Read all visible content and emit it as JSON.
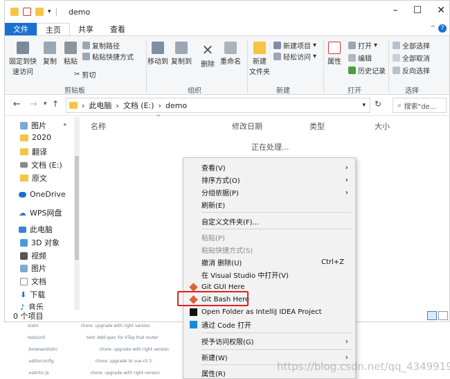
{
  "window": {
    "title": "demo",
    "minimize_glyph": "–",
    "maximize_glyph": "☐",
    "close_glyph": "✕"
  },
  "ribbon_tabs": [
    "文件",
    "主页",
    "共享",
    "查看"
  ],
  "ribbon": {
    "pin_label": "固定到快\n速访问",
    "copy_label": "复制",
    "paste_label": "粘贴",
    "copy_path": "复制路径",
    "paste_shortcut": "粘贴快捷方式",
    "cut": "剪切",
    "clipboard_group": "剪贴板",
    "move_to": "移动到",
    "copy_to": "复制到",
    "delete": "删除",
    "rename": "重命名",
    "organize_group": "组织",
    "new_folder": "新建\n文件夹",
    "new_item": "新建项目",
    "easy_access": "轻松访问",
    "new_group": "新建",
    "properties": "属性",
    "open": "打开",
    "edit": "编辑",
    "history": "历史记录",
    "open_group": "打开",
    "select_all": "全部选择",
    "select_none": "全部取消",
    "invert_select": "反向选择",
    "select_group": "选择"
  },
  "address": {
    "path": [
      "此电脑",
      "文档 (E:)",
      "demo"
    ],
    "search_placeholder": "搜索\"de..."
  },
  "nav": {
    "items": [
      "图片",
      "2020",
      "翻译",
      "文档 (E:)",
      "原文",
      "OneDrive",
      "WPS网盘",
      "此电脑",
      "3D 对象",
      "视频",
      "图片",
      "文档",
      "下载",
      "音乐"
    ]
  },
  "columns": {
    "name": "名称",
    "modified": "修改日期",
    "type": "类型",
    "size": "大小"
  },
  "processing_text": "正在处理...",
  "status": {
    "count": "0 个项目"
  },
  "context_menu": [
    {
      "label": "查看(V)",
      "arrow": true
    },
    {
      "label": "排序方式(O)",
      "arrow": true
    },
    {
      "label": "分组依据(P)",
      "arrow": true
    },
    {
      "label": "刷新(E)"
    },
    {
      "label": "自定义文件夹(F)..."
    },
    {
      "label": "粘贴(P)",
      "disabled": true
    },
    {
      "label": "粘贴快捷方式(S)",
      "disabled": true
    },
    {
      "label": "撤消 删除(U)",
      "accel": "Ctrl+Z"
    },
    {
      "label": "在 Visual Studio 中打开(V)"
    },
    {
      "label": "Git GUI Here"
    },
    {
      "label": "Git Bash Here"
    },
    {
      "label": "Open Folder as IntelliJ IDEA Project"
    },
    {
      "label": "通过 Code 打开"
    },
    {
      "label": "授予访问权限(G)",
      "arrow": true
    },
    {
      "label": "新建(W)",
      "arrow": true
    },
    {
      "label": "属性(R)"
    }
  ],
  "background_rows": [
    {
      "name": "static",
      "msg": "chore: upgrade with right version"
    },
    {
      "name": "test/unit",
      "msg": "test: Add spec for VTag that router"
    },
    {
      "name": ".browserslistrc",
      "msg": "chore: upgrade with right version"
    },
    {
      "name": ".editorconfig",
      "msg": "chore: upgrade to vue-cli 3"
    },
    {
      "name": ".eslintrc.js",
      "msg": "chore: upgrade with right version"
    }
  ],
  "watermark": "https://blog.csdn.net/qq_43499191",
  "colors": {
    "accent": "#1a6fd0",
    "highlight": "#e02020",
    "folder": "#f6c445"
  }
}
